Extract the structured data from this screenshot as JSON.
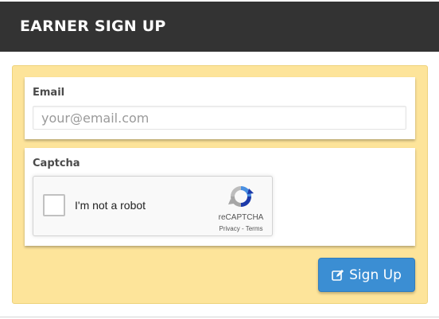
{
  "header": {
    "title": "EARNER SIGN UP"
  },
  "email": {
    "label": "Email",
    "placeholder": "your@email.com",
    "value": ""
  },
  "captcha": {
    "label": "Captcha",
    "checkbox_label": "I'm not a robot",
    "brand": "reCAPTCHA",
    "links": "Privacy - Terms"
  },
  "actions": {
    "signup_label": "Sign Up",
    "signup_icon": "edit-icon"
  },
  "colors": {
    "header_bg": "#333333",
    "panel_bg": "#fde49a",
    "button_bg": "#3b8ed3"
  }
}
